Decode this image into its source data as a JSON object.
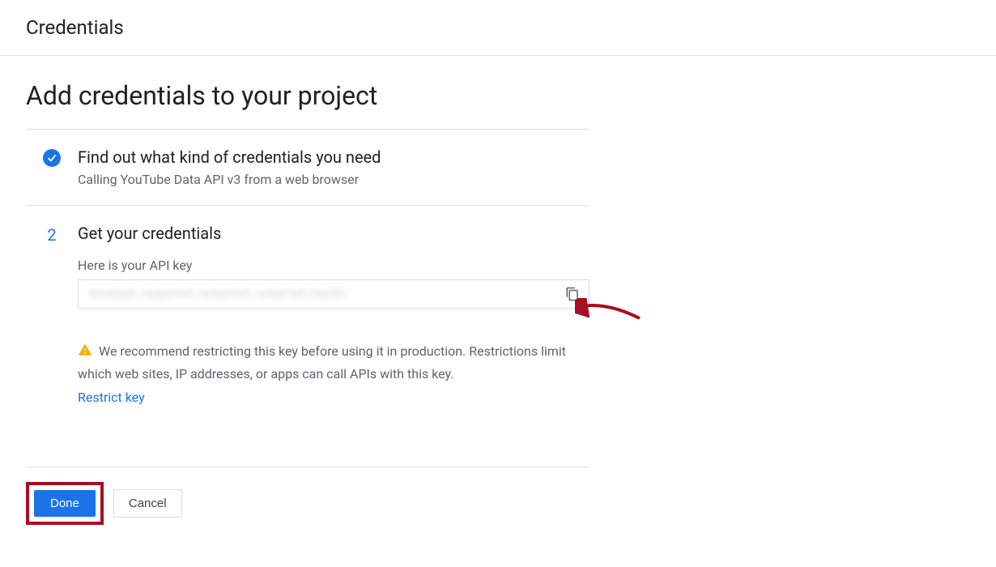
{
  "header": {
    "title": "Credentials"
  },
  "main": {
    "title": "Add credentials to your project"
  },
  "step1": {
    "title": "Find out what kind of credentials you need",
    "subtitle": "Calling YouTube Data API v3 from a web browser"
  },
  "step2": {
    "number": "2",
    "title": "Get your credentials",
    "api_key_label": "Here is your API key",
    "api_key_value": "AIzaSyD_redacted_redacted_redacted_key00",
    "warning_text": "We recommend restricting this key before using it in production. Restrictions limit which web sites, IP addresses, or apps can call APIs with this key.",
    "restrict_link": "Restrict key"
  },
  "footer": {
    "done_label": "Done",
    "cancel_label": "Cancel"
  },
  "colors": {
    "primary": "#1a73e8",
    "warning": "#f9ab00",
    "annotation": "#a60f24"
  }
}
